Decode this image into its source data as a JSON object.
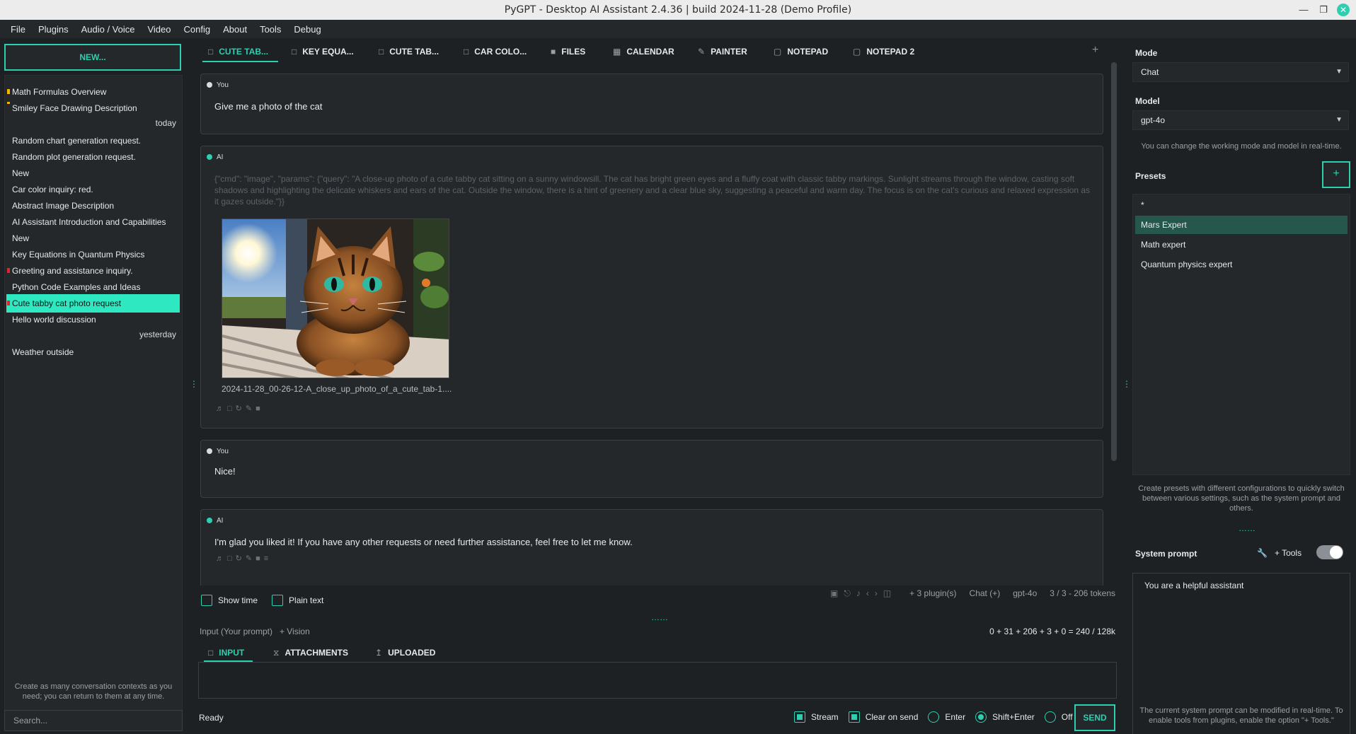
{
  "window": {
    "title": "PyGPT - Desktop AI Assistant 2.4.36 | build 2024-11-28 (Demo Profile)",
    "minimize_icon": "minimize-icon",
    "maximize_icon": "maximize-icon",
    "close_icon": "close-icon"
  },
  "menu": [
    "File",
    "Plugins",
    "Audio / Voice",
    "Video",
    "Config",
    "About",
    "Tools",
    "Debug"
  ],
  "left": {
    "new_label": "NEW...",
    "contexts": [
      {
        "label": "Math Formulas Overview",
        "mark": "#f5b400"
      },
      {
        "label": "Smiley Face Drawing Description",
        "mark": "#f5b400"
      },
      {
        "label": "Random chart generation request."
      },
      {
        "label": "Random plot generation request."
      },
      {
        "label": "New"
      },
      {
        "label": "Car color inquiry: red."
      },
      {
        "label": "Abstract Image Description"
      },
      {
        "label": "AI Assistant Introduction and Capabilities"
      },
      {
        "label": "New"
      },
      {
        "label": "Key Equations in Quantum Physics"
      },
      {
        "label": "Greeting and assistance inquiry.",
        "mark": "#e0262b"
      },
      {
        "label": "Python Code Examples and Ideas"
      },
      {
        "label": "Cute tabby cat photo request",
        "mark": "#e0262b",
        "active": true
      },
      {
        "label": "Hello world discussion"
      },
      {
        "label": "Weather outside"
      }
    ],
    "group_today": "today",
    "group_yesterday": "yesterday",
    "hint": "Create as many conversation contexts as you need; you can return to them at any time.",
    "search_placeholder": "Search..."
  },
  "tabs": [
    {
      "label": "CUTE TAB...",
      "icon": "chat-icon",
      "active": true
    },
    {
      "label": "KEY EQUA...",
      "icon": "chat-icon"
    },
    {
      "label": "CUTE TAB...",
      "icon": "chat-icon"
    },
    {
      "label": "CAR COLO...",
      "icon": "chat-icon"
    },
    {
      "label": "FILES",
      "icon": "folder-icon"
    },
    {
      "label": "CALENDAR",
      "icon": "calendar-icon"
    },
    {
      "label": "PAINTER",
      "icon": "pencil-icon"
    },
    {
      "label": "NOTEPAD",
      "icon": "notepad-icon"
    },
    {
      "label": "NOTEPAD 2",
      "icon": "notepad-icon"
    }
  ],
  "add_tab": "+",
  "messages": {
    "m1_who": "You",
    "m1_text": "Give me a photo of the cat",
    "m2_who": "AI",
    "m2_cmd": "{\"cmd\": \"image\", \"params\": {\"query\": \"A close-up photo of a cute tabby cat sitting on a sunny windowsill. The cat has bright green eyes and a fluffy coat with classic tabby markings. Sunlight streams through the window, casting soft shadows and highlighting the delicate whiskers and ears of the cat. Outside the window, there is a hint of greenery and a clear blue sky, suggesting a peaceful and warm day. The focus is on the cat's curious and relaxed expression as it gazes outside.\"}}",
    "m2_caption": "2024-11-28_00-26-12-A_close_up_photo_of_a_cute_tab-1....",
    "m3_who": "You",
    "m3_text": "Nice!",
    "m4_who": "AI",
    "m4_text": "I'm glad you liked it! If you have any other requests or need further assistance, feel free to let me know."
  },
  "options": {
    "show_time": "Show time",
    "plain_text": "Plain text"
  },
  "status": {
    "plugins": "+ 3 plugin(s)",
    "mode": "Chat (+)",
    "model": "gpt-4o",
    "ctx_tokens": "3 / 3 - 206 tokens"
  },
  "input": {
    "label": "Input (Your prompt)",
    "vision": "+ Vision",
    "tokens": "0 + 31 + 206 + 3 + 0 = 240 / 128k",
    "tabs": [
      {
        "label": "INPUT",
        "icon": "chat-icon",
        "active": true
      },
      {
        "label": "ATTACHMENTS",
        "icon": "paperclip-icon"
      },
      {
        "label": "UPLOADED",
        "icon": "upload-icon"
      }
    ],
    "ready": "Ready",
    "stream": "Stream",
    "clear_on_send": "Clear on send",
    "enter": "Enter",
    "shift_enter": "Shift+Enter",
    "off": "Off",
    "send": "SEND"
  },
  "right": {
    "mode_label": "Mode",
    "mode_value": "Chat",
    "model_label": "Model",
    "model_value": "gpt-4o",
    "model_hint": "You can change the working mode and model in real-time.",
    "presets_label": "Presets",
    "presets_add": "+",
    "presets": [
      {
        "label": "*"
      },
      {
        "label": "Mars Expert",
        "selected": true
      },
      {
        "label": "Math expert"
      },
      {
        "label": "Quantum physics expert"
      }
    ],
    "presets_hint": "Create presets with different configurations to quickly switch between various settings, such as the system prompt and others.",
    "sysprompt_label": "System prompt",
    "tools_label": "+ Tools",
    "sysprompt_value": "You are a helpful assistant",
    "sysprompt_hint": "The current system prompt can be modified in real-time. To enable tools from plugins, enable the option \"+ Tools.\""
  },
  "colors": {
    "accent": "#2ecfb0",
    "active_context": "#2ee8c1",
    "selected_preset": "#25574c",
    "background": "#1e2124",
    "panel": "#25282b"
  }
}
